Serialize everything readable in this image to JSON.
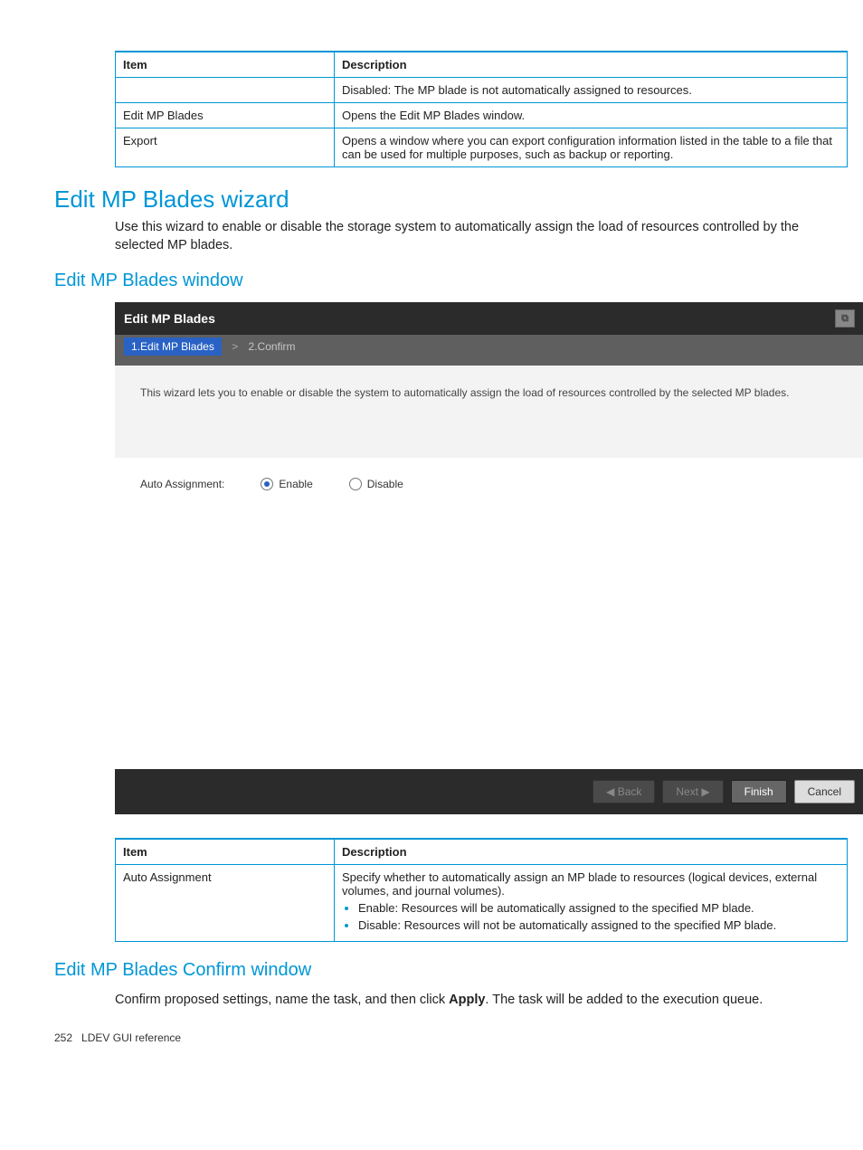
{
  "table1": {
    "headers": [
      "Item",
      "Description"
    ],
    "rows": [
      {
        "item": "",
        "desc": "Disabled: The MP blade is not automatically assigned to resources."
      },
      {
        "item": "Edit MP Blades",
        "desc": "Opens the Edit MP Blades window."
      },
      {
        "item": "Export",
        "desc": "Opens a window where you can export configuration information listed in the table to a file that can be used for multiple purposes, such as backup or reporting."
      }
    ]
  },
  "section1": {
    "title": "Edit MP Blades wizard",
    "body": "Use this wizard to enable or disable the storage system to automatically assign the load of resources controlled by the selected MP blades."
  },
  "subsection1": {
    "title": "Edit MP Blades window"
  },
  "shot": {
    "title": "Edit MP Blades",
    "step1": "1.Edit MP Blades",
    "sep": ">",
    "step2": "2.Confirm",
    "body": "This wizard lets you to enable or disable the system to automatically assign the load of resources controlled by the selected MP blades.",
    "option_label": "Auto Assignment:",
    "radio_enable": "Enable",
    "radio_disable": "Disable",
    "btn_back": "◀ Back",
    "btn_next": "Next ▶",
    "btn_finish": "Finish",
    "btn_cancel": "Cancel"
  },
  "table2": {
    "headers": [
      "Item",
      "Description"
    ],
    "row": {
      "item": "Auto Assignment",
      "desc_intro": "Specify whether to automatically assign an MP blade to resources (logical devices, external volumes, and journal volumes).",
      "bullet1": "Enable: Resources will be automatically assigned to the specified MP blade.",
      "bullet2": "Disable: Resources will not be automatically assigned to the specified MP blade."
    }
  },
  "subsection2": {
    "title": "Edit MP Blades Confirm window",
    "body_pre": "Confirm proposed settings, name the task, and then click ",
    "body_bold": "Apply",
    "body_post": ". The task will be added to the execution queue."
  },
  "footer": {
    "page": "252",
    "ref": "LDEV GUI reference"
  }
}
